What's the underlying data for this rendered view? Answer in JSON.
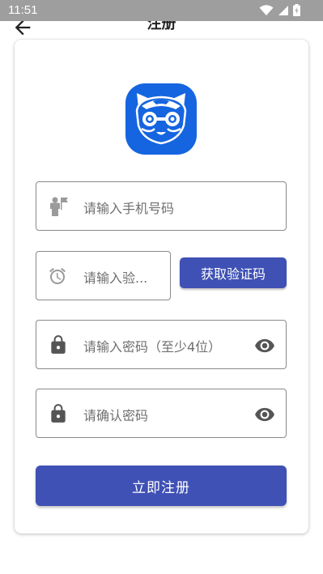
{
  "status_bar": {
    "time": "11:51"
  },
  "app_bar": {
    "title": "注册"
  },
  "form": {
    "phone_placeholder": "请输入手机号码",
    "code_placeholder": "请输入验...",
    "get_code_label": "获取验证码",
    "password_placeholder": "请输入密码（至少4位）",
    "confirm_placeholder": "请确认密码",
    "submit_label": "立即注册"
  },
  "colors": {
    "primary": "#3f51b5",
    "status_bar": "#9e9e9e",
    "logo_bg": "#1565e0"
  },
  "icons": [
    "back-arrow-icon",
    "person-icon",
    "alarm-icon",
    "lock-icon",
    "eye-icon",
    "app-logo"
  ]
}
